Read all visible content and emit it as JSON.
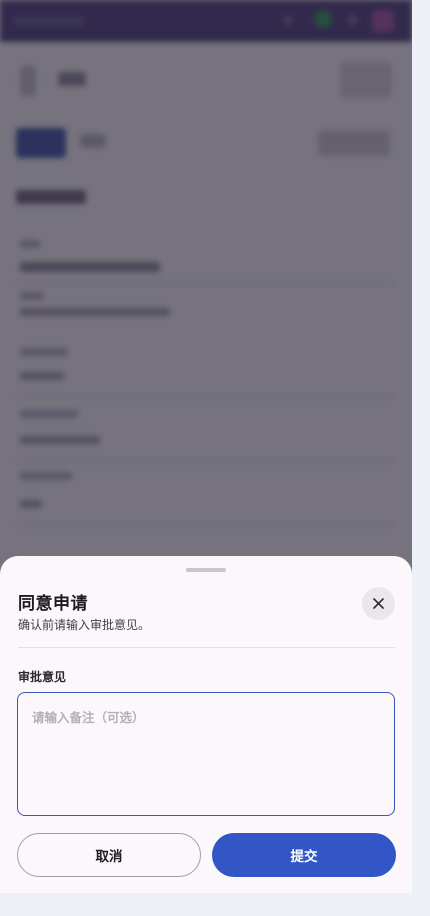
{
  "dialog": {
    "title": "同意申请",
    "subtitle": "确认前请输入审批意见。",
    "field_label": "审批意见",
    "input_placeholder": "请输入备注（可选）",
    "input_value": "",
    "cancel_label": "取消",
    "submit_label": "提交"
  },
  "colors": {
    "accent": "#3356c6",
    "topbar": "#4a3b79",
    "sheet_background": "#fbf7fa",
    "overlay": "rgba(35,32,48,0.62)"
  },
  "icons": {
    "close": "close-icon"
  }
}
